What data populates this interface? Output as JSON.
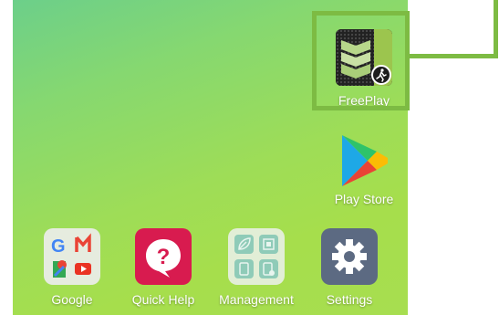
{
  "apps": {
    "freeplay": {
      "label": "FreePlay"
    },
    "play_store": {
      "label": "Play Store"
    },
    "google": {
      "label": "Google"
    },
    "quick_help": {
      "label": "Quick Help"
    },
    "management": {
      "label": "Management"
    },
    "settings": {
      "label": "Settings"
    }
  },
  "colors": {
    "highlight": "#7dbb43",
    "quick_help": "#d81b4f",
    "settings": "#5c6a82",
    "folder_bg": "#e8f2df"
  }
}
